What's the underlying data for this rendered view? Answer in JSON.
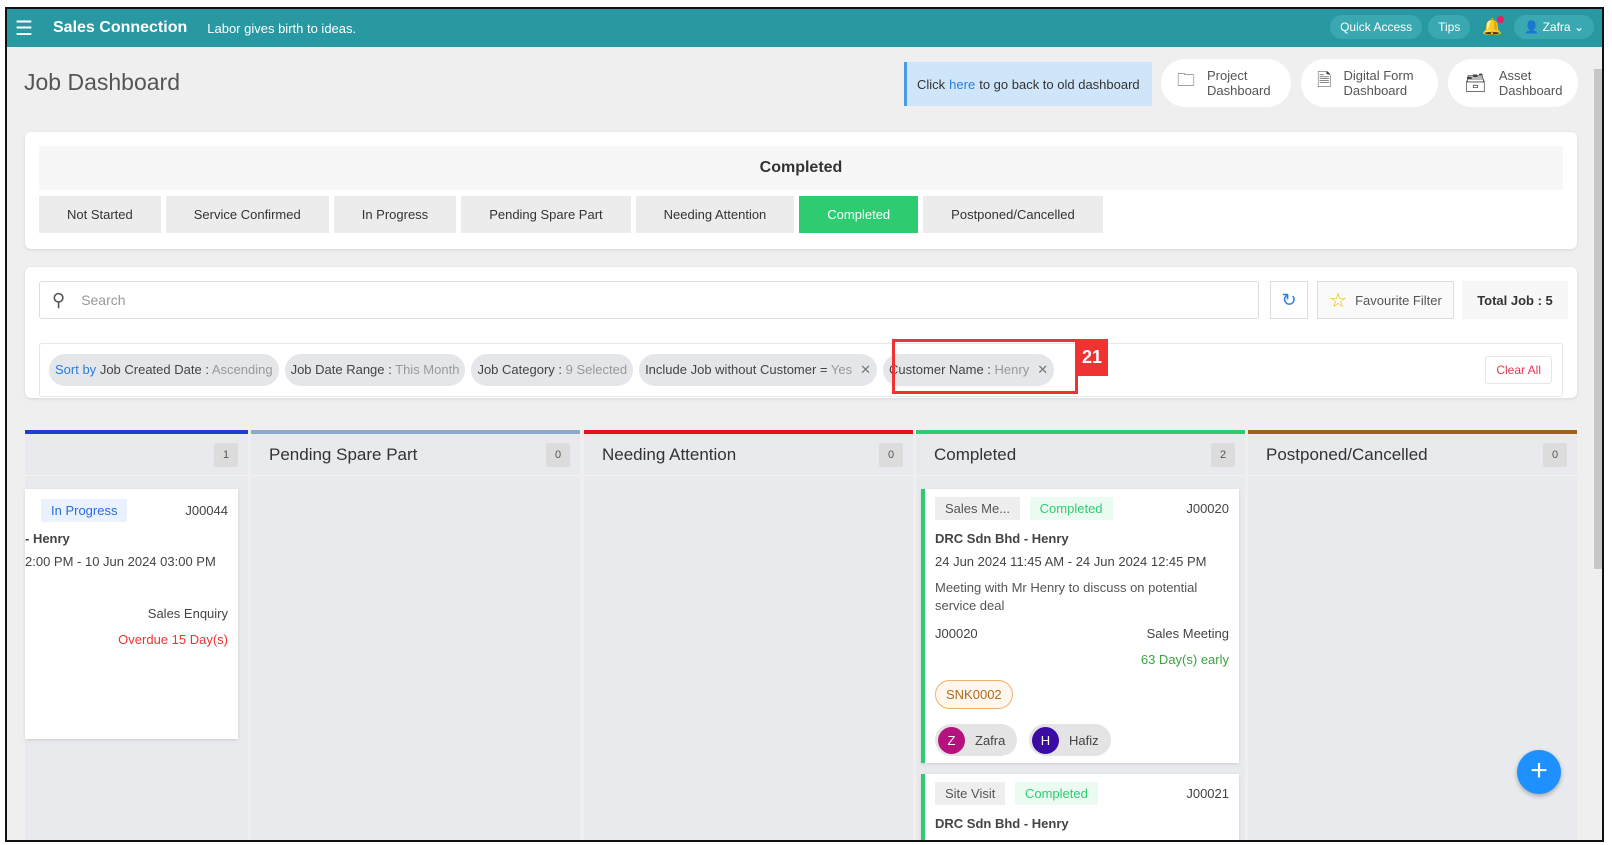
{
  "topbar": {
    "brand": "Sales Connection",
    "tagline": "Labor gives birth to ideas.",
    "quick_access": "Quick Access",
    "tips": "Tips",
    "user": "Zafra"
  },
  "page": {
    "title": "Job Dashboard",
    "old_prefix": "Click",
    "old_link": "here",
    "old_suffix": "to go back to old dashboard"
  },
  "dashboards": [
    {
      "line1": "Project",
      "line2": "Dashboard"
    },
    {
      "line1": "Digital Form",
      "line2": "Dashboard"
    },
    {
      "line1": "Asset",
      "line2": "Dashboard"
    }
  ],
  "status": {
    "heading": "Completed",
    "tabs": [
      "Not Started",
      "Service Confirmed",
      "In Progress",
      "Pending Spare Part",
      "Needing Attention",
      "Completed",
      "Postponed/Cancelled"
    ],
    "active": "Completed"
  },
  "search": {
    "placeholder": "Search",
    "favourite": "Favourite Filter",
    "total": "Total Job : 5"
  },
  "filters": {
    "sort": {
      "prefix": "Sort by",
      "key": "Job Created Date :",
      "value": "Ascending"
    },
    "date": {
      "key": "Job Date Range :",
      "value": "This Month"
    },
    "category": {
      "key": "Job Category :",
      "value": "9 Selected"
    },
    "nocust": {
      "key": "Include Job without Customer =",
      "value": "Yes"
    },
    "customer": {
      "key": "Customer Name :",
      "value": "Henry"
    },
    "clear": "Clear All",
    "annotation": "21"
  },
  "columns": [
    {
      "title": "",
      "count": "1",
      "color": "#1c3fd1"
    },
    {
      "title": "Pending Spare Part",
      "count": "0",
      "color": "#8aaac8"
    },
    {
      "title": "Needing Attention",
      "count": "0",
      "color": "#e8101a"
    },
    {
      "title": "Completed",
      "count": "2",
      "color": "#2ecc71"
    },
    {
      "title": "Postponed/Cancelled",
      "count": "0",
      "color": "#a0621a"
    }
  ],
  "cards": {
    "inprogress": {
      "status": "In Progress",
      "id": "J00044",
      "customer": "- Henry",
      "time": "2:00 PM - 10 Jun 2024 03:00 PM",
      "category": "Sales Enquiry",
      "due": "Overdue 15 Day(s)"
    },
    "c1": {
      "type": "Sales Me...",
      "status": "Completed",
      "id": "J00020",
      "customer": "DRC Sdn Bhd - Henry",
      "time": "24 Jun 2024 11:45 AM - 24 Jun 2024 12:45 PM",
      "desc": "Meeting with Mr Henry to discuss on potential service deal",
      "ref": "J00020",
      "category": "Sales Meeting",
      "due": "63 Day(s) early",
      "tag": "SNK0002",
      "assignees": [
        {
          "initial": "Z",
          "name": "Zafra",
          "color": "#b5127d"
        },
        {
          "initial": "H",
          "name": "Hafiz",
          "color": "#3a0ca3"
        }
      ]
    },
    "c2": {
      "type": "Site Visit",
      "status": "Completed",
      "id": "J00021",
      "customer": "DRC Sdn Bhd - Henry"
    }
  }
}
